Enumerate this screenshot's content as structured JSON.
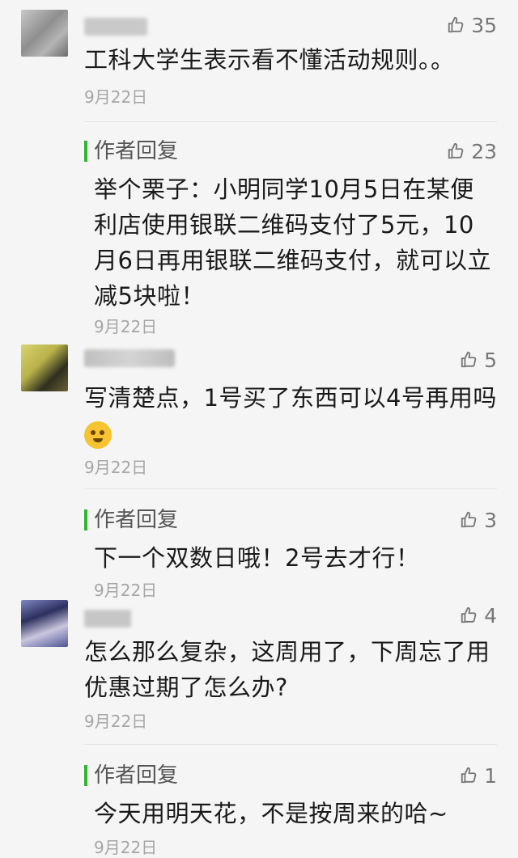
{
  "comments": [
    {
      "likes": "35",
      "text": "工科大学生表示看不懂活动规则。。",
      "date": "9月22日",
      "reply": {
        "label": "作者回复",
        "likes": "23",
        "text": "举个栗子：小明同学10月5日在某便利店使用银联二维码支付了5元，10月6日再用银联二维码支付，就可以立减5块啦！",
        "date": "9月22日"
      }
    },
    {
      "likes": "5",
      "text": "写清楚点，1号买了东西可以4号再用吗",
      "date": "9月22日",
      "reply": {
        "label": "作者回复",
        "likes": "3",
        "text": "下一个双数日哦！2号去才行！",
        "date": "9月22日"
      }
    },
    {
      "likes": "4",
      "text": "怎么那么复杂，这周用了，下周忘了用优惠过期了怎么办?",
      "date": "9月22日",
      "reply": {
        "label": "作者回复",
        "likes": "1",
        "text": "今天用明天花，不是按周来的哈~",
        "date": "9月22日"
      }
    }
  ],
  "colors": {
    "reply_accent": "#2fb531",
    "meta": "#a6a6a6",
    "like": "#777777"
  },
  "icons": {
    "like": "thumbs-up-icon",
    "emoji": "grinning-face-emoji"
  }
}
